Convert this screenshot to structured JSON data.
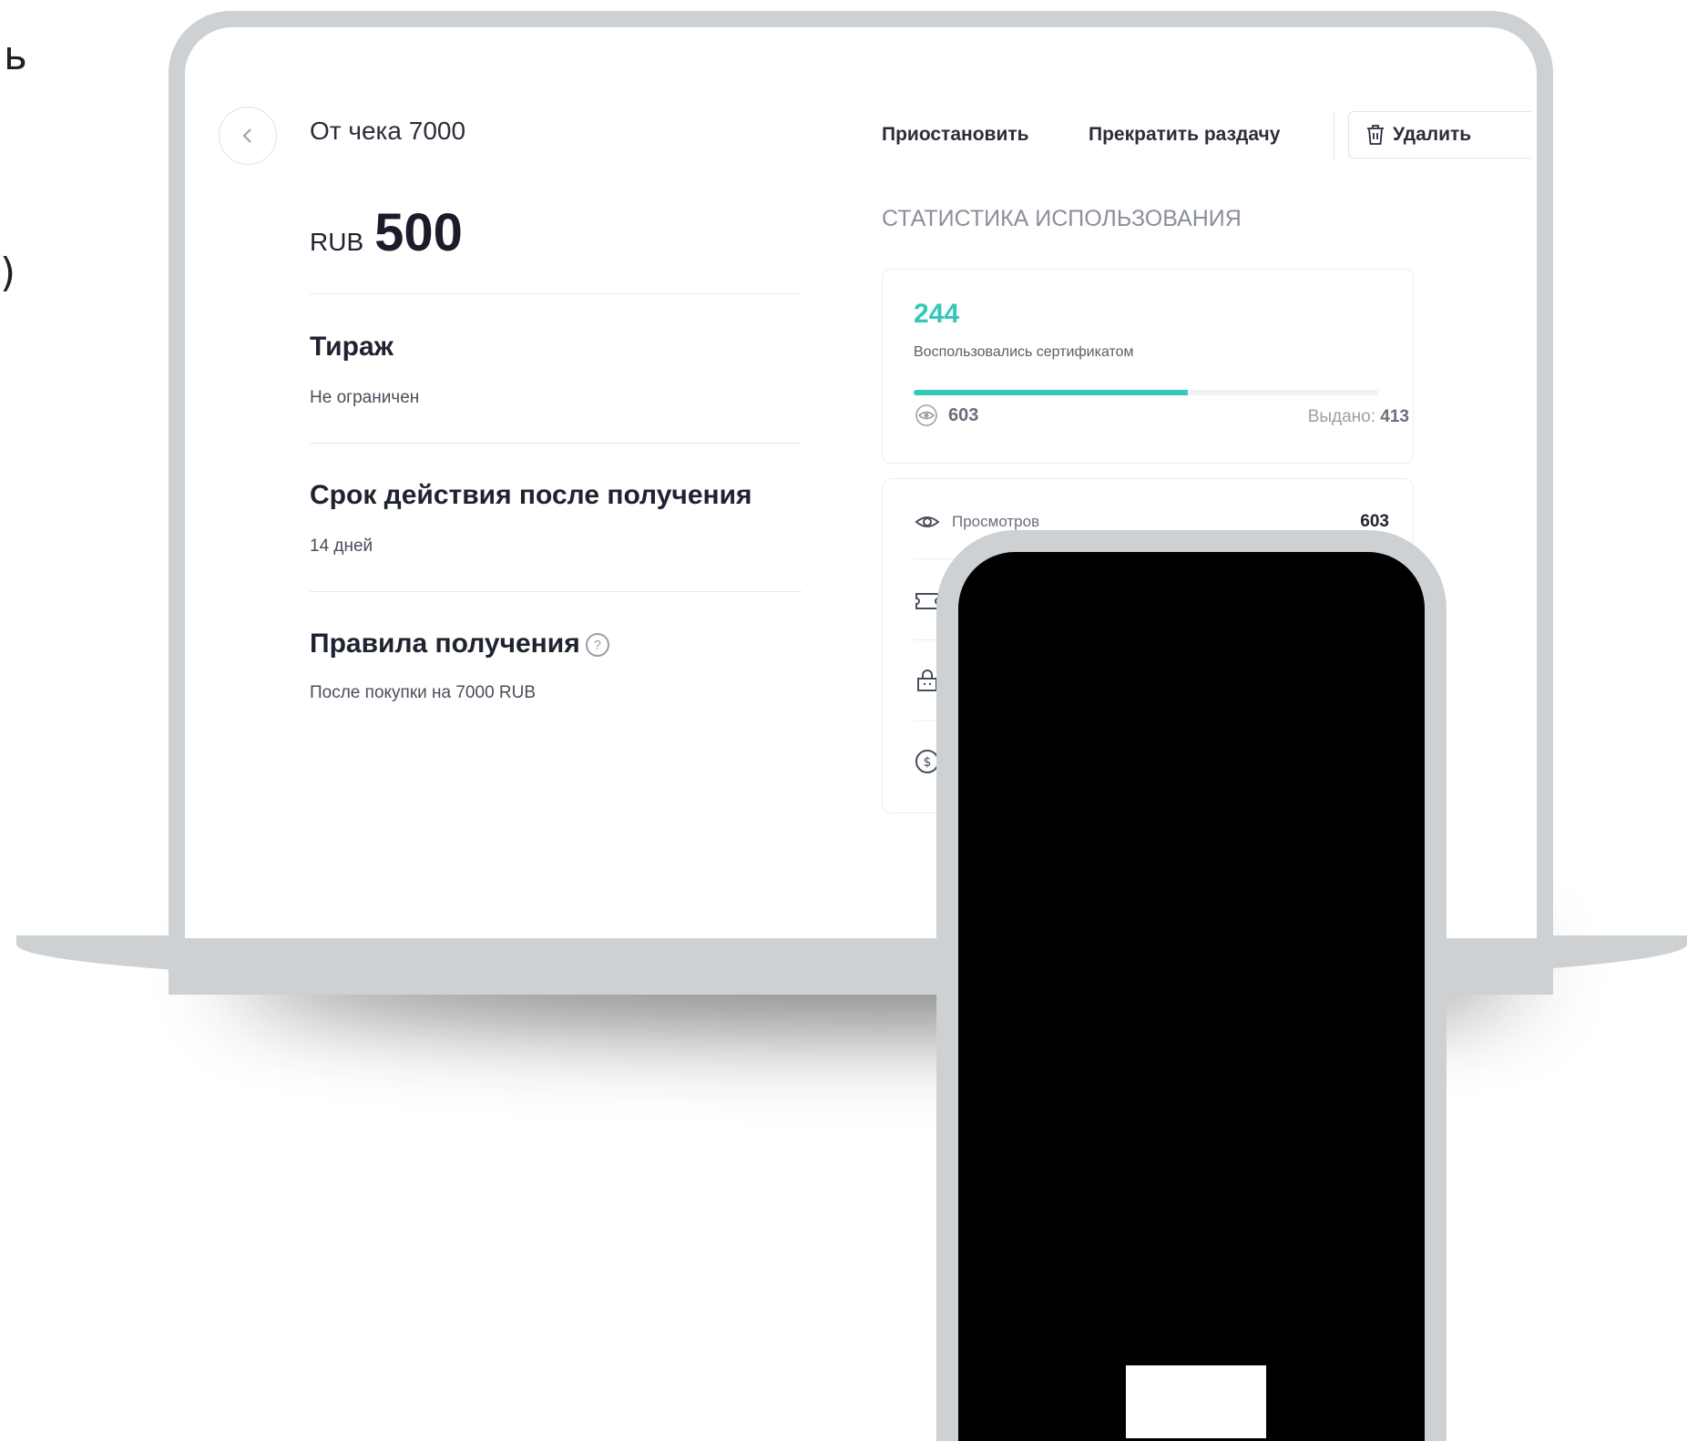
{
  "edge_glyphs": {
    "top": "ь",
    "middle": ")"
  },
  "page": {
    "title": "От чека 7000",
    "price": {
      "currency": "RUB",
      "amount": "500"
    },
    "sections": [
      {
        "heading": "Тираж",
        "value": "Не ограничен"
      },
      {
        "heading": "Срок действия после получения",
        "value": "14 дней"
      },
      {
        "heading": "Правила получения",
        "value": "После покупки на 7000 RUB"
      }
    ]
  },
  "actions": {
    "pause": "Приостановить",
    "stop": "Прекратить раздачу",
    "delete": "Удалить"
  },
  "stats": {
    "title": "СТАТИСТИКА ИСПОЛЬЗОВАНИЯ",
    "used_count": "244",
    "used_label": "Воспользовались сертификатом",
    "views": "603",
    "issued_label": "Выдано:",
    "issued_value": "413",
    "rows": [
      {
        "label": "Просмотров",
        "value": "603",
        "icon": "eye-icon"
      }
    ],
    "hidden_row_icons": [
      "ticket-icon",
      "bag-icon",
      "dollar-icon"
    ]
  },
  "colors": {
    "accent": "#34c8b8",
    "device_frame": "#cdd1d4",
    "phone_screen": "#000000"
  }
}
